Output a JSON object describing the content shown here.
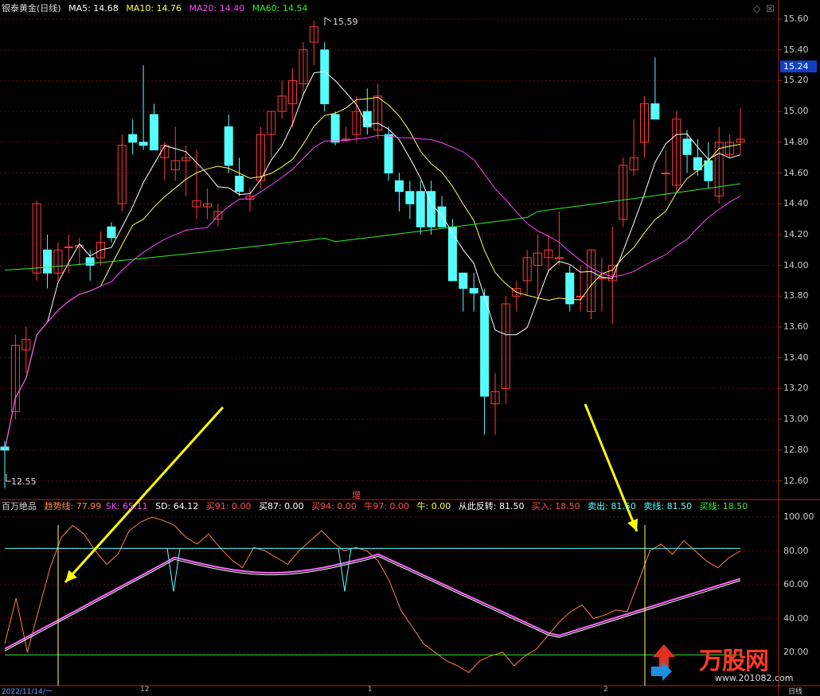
{
  "header": {
    "title": "银泰黄金(日线)",
    "ma5": "MA5: 14.68",
    "ma10": "MA10: 14.76",
    "ma20": "MA20: 14.40",
    "ma60": "MA60: 14.54"
  },
  "price_axis": [
    "15.60",
    "15.40",
    "15.20",
    "15.00",
    "14.80",
    "14.60",
    "14.40",
    "14.20",
    "14.00",
    "13.80",
    "13.60",
    "13.40",
    "13.20",
    "13.00",
    "12.80",
    "12.60"
  ],
  "current_price": "15.24",
  "high_mark": "15.59",
  "low_mark": "12.55",
  "zeng_label": "增",
  "indicator": {
    "name": "百万绝品",
    "trend": "趋势线: 77.99",
    "sk": "SK: 65.11",
    "sd": "SD: 64.12",
    "buy91": "买91: 0.00",
    "buy87": "买87: 0.00",
    "buy94": "买94: 0.00",
    "bull97": "牛97: 0.00",
    "bull": "牛: 0.00",
    "reverse": "从此反转: 81.50",
    "buy_in": "买入: 18.50",
    "sell_out": "卖出: 81.50",
    "sell_line": "卖线: 81.50",
    "buy_line": "买线: 18.50"
  },
  "ind_axis": [
    "100.00",
    "80.00",
    "60.00",
    "40.00",
    "20.00"
  ],
  "bottom": {
    "date": "2022/11/14/一",
    "tick1": "12",
    "tick2": "1",
    "tick3": "2",
    "period": "日线"
  },
  "logo": {
    "text": "万股网",
    "url": "www.201082.com"
  },
  "colors": {
    "up": "#ff3b3b",
    "down": "#54ffff",
    "ma5": "#ffffff",
    "ma10": "#ffff55",
    "ma20": "#ff44ff",
    "ma60": "#33ee33",
    "arrow": "#ffff00"
  }
}
